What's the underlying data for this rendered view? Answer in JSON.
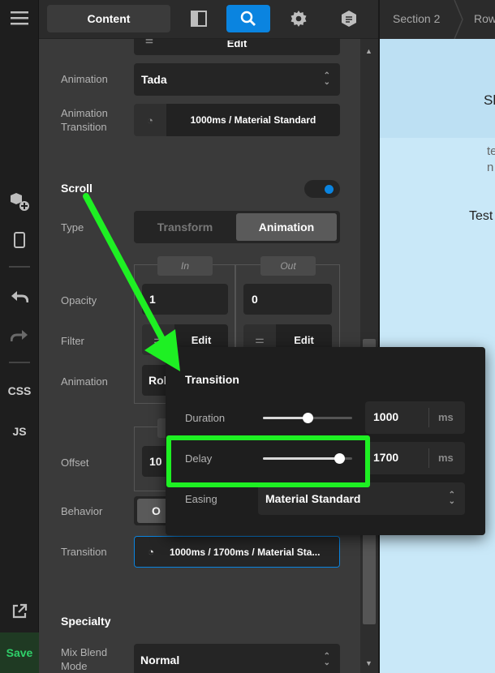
{
  "rail": {
    "items": [
      {
        "icon": "menu-icon"
      },
      {
        "icon": "add-component-icon"
      },
      {
        "icon": "mobile-preview-icon"
      },
      {
        "icon": "undo-icon"
      },
      {
        "icon": "redo-icon"
      },
      {
        "label": "CSS"
      },
      {
        "label": "JS"
      },
      {
        "icon": "external-link-icon"
      }
    ],
    "save_label": "Save"
  },
  "topbar": {
    "tab_content": "Content",
    "icons": [
      "layout-icon",
      "search-icon",
      "gear-icon",
      "template-icon"
    ],
    "active_icon": "search-icon"
  },
  "breadcrumbs": [
    "Section 2",
    "Row"
  ],
  "canvas_text": [
    "Sh",
    "te",
    "n",
    "Test"
  ],
  "panel": {
    "filter_edit": "Edit",
    "animation": {
      "label": "Animation",
      "value": "Tada"
    },
    "animation_transition": {
      "label": "Animation Transition",
      "value": "1000ms / Material Standard"
    },
    "scroll": {
      "heading": "Scroll",
      "type": {
        "label": "Type",
        "options": [
          "Transform",
          "Animation"
        ],
        "selected": "Animation"
      },
      "in_label": "In",
      "out_label": "Out",
      "opacity": {
        "label": "Opacity",
        "in": "1",
        "out": "0"
      },
      "filter": {
        "label": "Filter",
        "in": "Edit",
        "out": "Edit"
      },
      "animation": {
        "label": "Animation",
        "in_partial": "Rol"
      },
      "offset": {
        "label": "Offset",
        "in_partial": "10"
      },
      "behavior": {
        "label": "Behavior",
        "value_partial": "O"
      },
      "transition": {
        "label": "Transition",
        "value": "1000ms / 1700ms / Material Sta..."
      }
    },
    "specialty": {
      "heading": "Specialty",
      "mix_blend": {
        "label": "Mix Blend Mode",
        "value": "Normal"
      }
    }
  },
  "transition_popover": {
    "title": "Transition",
    "duration": {
      "label": "Duration",
      "value": "1000",
      "unit": "ms",
      "level": 0.5
    },
    "delay": {
      "label": "Delay",
      "value": "1700",
      "unit": "ms",
      "level": 0.85
    },
    "easing": {
      "label": "Easing",
      "value": "Material Standard"
    }
  },
  "colors": {
    "accent": "#0a84e0",
    "highlight": "#1ef023",
    "canvas": "#c9e8f8"
  }
}
